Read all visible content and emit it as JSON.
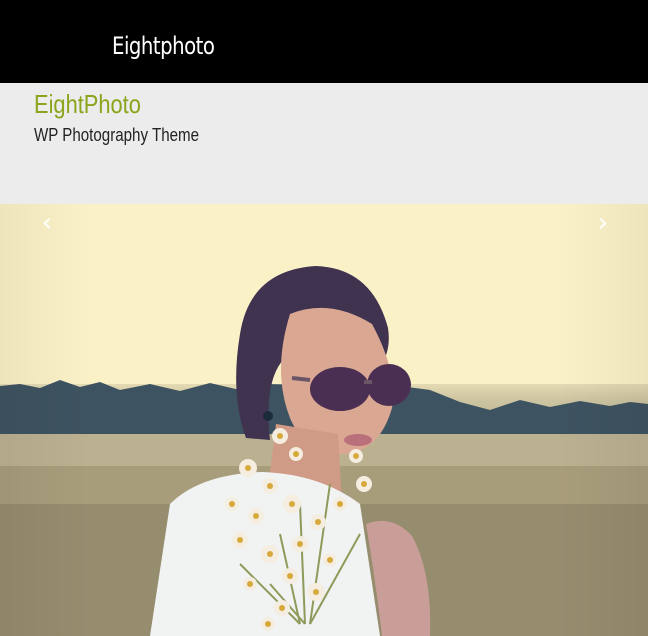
{
  "topbar": {
    "logo_text": "Eightphoto"
  },
  "header": {
    "title": "EightPhoto",
    "tagline": "WP Photography Theme"
  },
  "slider": {
    "prev_icon": "‹",
    "next_icon": "›"
  },
  "colors": {
    "title_accent": "#8aa51b",
    "topbar_bg": "#000000",
    "header_bg": "#ececec"
  }
}
